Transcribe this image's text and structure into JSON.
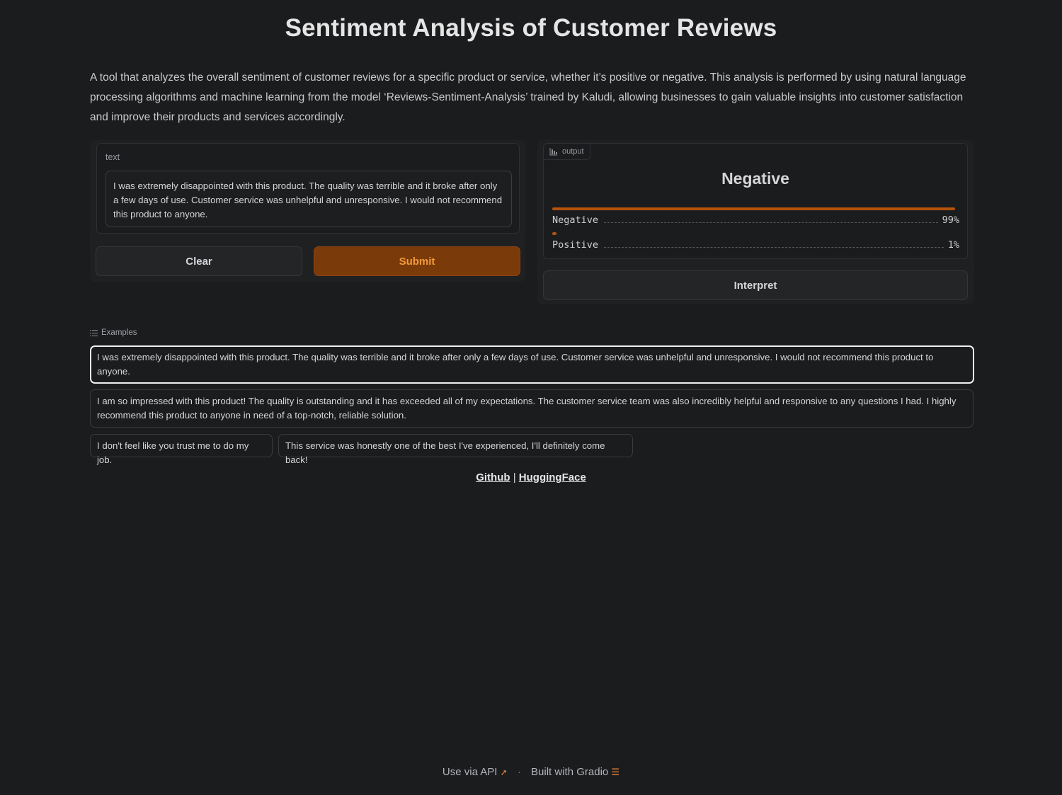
{
  "app": {
    "title": "Sentiment Analysis of Customer Reviews",
    "description": "A tool that analyzes the overall sentiment of customer reviews for a specific product or service, whether it’s positive or negative. This analysis is performed by using natural language processing algorithms and machine learning from the model ‘Reviews-Sentiment-Analysis’ trained by Kaludi, allowing businesses to gain valuable insights into customer satisfaction and improve their products and services accordingly."
  },
  "input": {
    "label": "text",
    "value": "I was extremely disappointed with this product. The quality was terrible and it broke after only a few days of use. Customer service was unhelpful and unresponsive. I would not recommend this product to anyone."
  },
  "buttons": {
    "clear": "Clear",
    "submit": "Submit",
    "interpret": "Interpret"
  },
  "output": {
    "tag": "output",
    "label": "Negative",
    "confidences": [
      {
        "name": "Negative",
        "value_text": "99%",
        "value": 0.99
      },
      {
        "name": "Positive",
        "value_text": "1%",
        "value": 0.01
      }
    ]
  },
  "examples": {
    "header": "Examples",
    "items": [
      "I was extremely disappointed with this product. The quality was terrible and it broke after only a few days of use. Customer service was unhelpful and unresponsive. I would not recommend this product to anyone.",
      "I am so impressed with this product! The quality is outstanding and it has exceeded all of my expectations. The customer service team was also incredibly helpful and responsive to any questions I had. I highly recommend this product to anyone in need of a top-notch, reliable solution.",
      "I don't feel like you trust me to do my job.",
      "This service was honestly one of the best I've experienced, I'll definitely come back!"
    ]
  },
  "links": {
    "github": "Github",
    "separator": "|",
    "huggingface": "HuggingFace"
  },
  "footer": {
    "api": "Use via API",
    "dot": "·",
    "built": "Built with Gradio"
  },
  "colors": {
    "accent": "#b4530c",
    "submit_text": "#f39a3a",
    "background": "#1b1c1e"
  }
}
